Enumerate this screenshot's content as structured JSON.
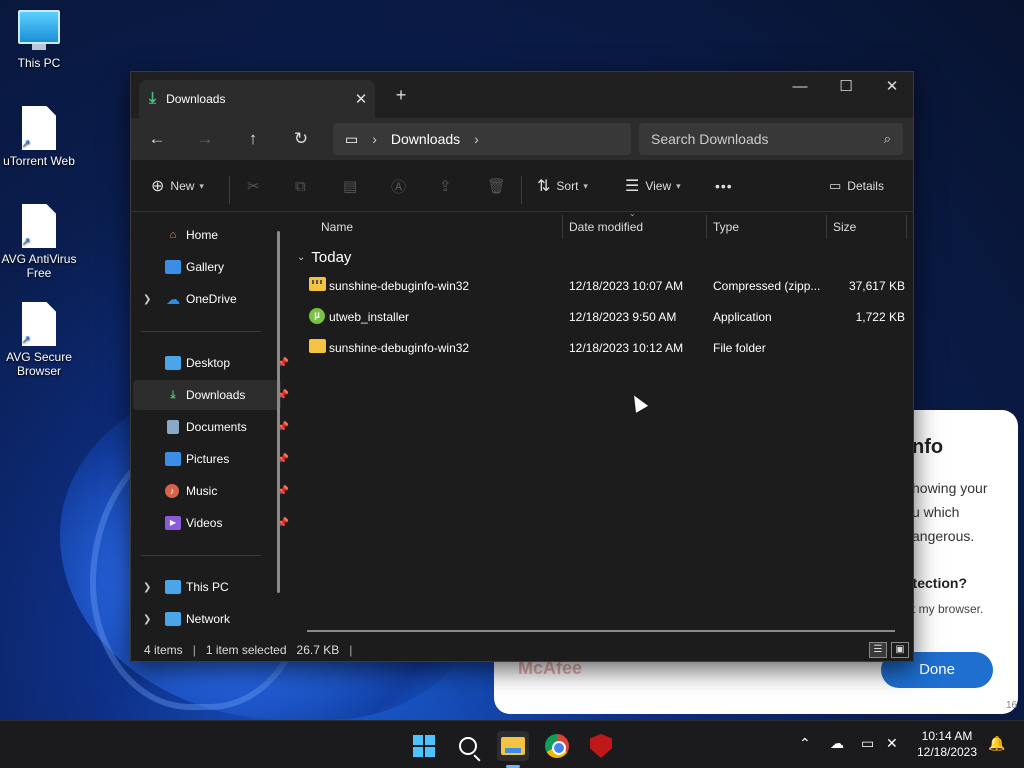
{
  "desktop": {
    "icons": [
      {
        "label": "This PC",
        "icon": "computer-icon"
      },
      {
        "label": "uTorrent Web",
        "icon": "shortcut-file-icon"
      },
      {
        "label": "AVG AntiVirus Free",
        "icon": "shortcut-file-icon"
      },
      {
        "label": "AVG Secure Browser",
        "icon": "shortcut-file-icon"
      }
    ]
  },
  "explorer": {
    "tab_title": "Downloads",
    "new_tab": "+",
    "window_controls": {
      "minimize": "—",
      "maximize": "☐",
      "close": "✕"
    },
    "nav": {
      "back": "←",
      "forward": "→",
      "up": "↑",
      "refresh": "↻"
    },
    "breadcrumb": {
      "root_icon": "monitor-icon",
      "items": [
        "Downloads"
      ]
    },
    "search": {
      "placeholder": "Search Downloads"
    },
    "toolbar": {
      "new_label": "New",
      "sort_label": "Sort",
      "view_label": "View",
      "more_label": "•••",
      "details_label": "Details"
    },
    "sidebar": {
      "items": [
        {
          "label": "Home",
          "icon": "home-icon",
          "color": "#e8a04a"
        },
        {
          "label": "Gallery",
          "icon": "gallery-icon",
          "color": "#3a8ee6"
        },
        {
          "label": "OneDrive",
          "icon": "cloud-icon",
          "color": "#2b8cf0"
        },
        {
          "label": "Desktop",
          "icon": "desktop-icon",
          "color": "#4aa6e8"
        },
        {
          "label": "Downloads",
          "icon": "download-icon",
          "color": "#46c37b"
        },
        {
          "label": "Documents",
          "icon": "document-icon",
          "color": "#8aa8c8"
        },
        {
          "label": "Pictures",
          "icon": "pictures-icon",
          "color": "#3a8ee6"
        },
        {
          "label": "Music",
          "icon": "music-icon",
          "color": "#d8634a"
        },
        {
          "label": "Videos",
          "icon": "videos-icon",
          "color": "#8a5ad8"
        },
        {
          "label": "This PC",
          "icon": "computer-icon",
          "color": "#4aa6e8"
        },
        {
          "label": "Network",
          "icon": "network-icon",
          "color": "#4aa6e8"
        }
      ]
    },
    "columns": {
      "name": "Name",
      "date": "Date modified",
      "type": "Type",
      "size": "Size"
    },
    "group_label": "Today",
    "files": [
      {
        "name": "sunshine-debuginfo-win32",
        "date": "12/18/2023 10:07 AM",
        "type": "Compressed (zipp...",
        "size": "37,617 KB",
        "icon": "zip-folder-icon"
      },
      {
        "name": "utweb_installer",
        "date": "12/18/2023 9:50 AM",
        "type": "Application",
        "size": "1,722 KB",
        "icon": "utorrent-app-icon"
      },
      {
        "name": "sunshine-debuginfo-win32",
        "date": "12/18/2023 10:12 AM",
        "type": "File folder",
        "size": "",
        "icon": "folder-icon"
      }
    ],
    "status": {
      "items": "4 items",
      "selected": "1 item selected",
      "size": "26.7 KB"
    }
  },
  "popup": {
    "title_fragment": "nfo",
    "lines": [
      "howing your",
      "u which",
      "angerous."
    ],
    "question": "otection?",
    "small_text": "t my browser.",
    "done_label": "Done",
    "brand": "McAfee",
    "footer": "16"
  },
  "taskbar": {
    "time": "10:14 AM",
    "date": "12/18/2023"
  }
}
